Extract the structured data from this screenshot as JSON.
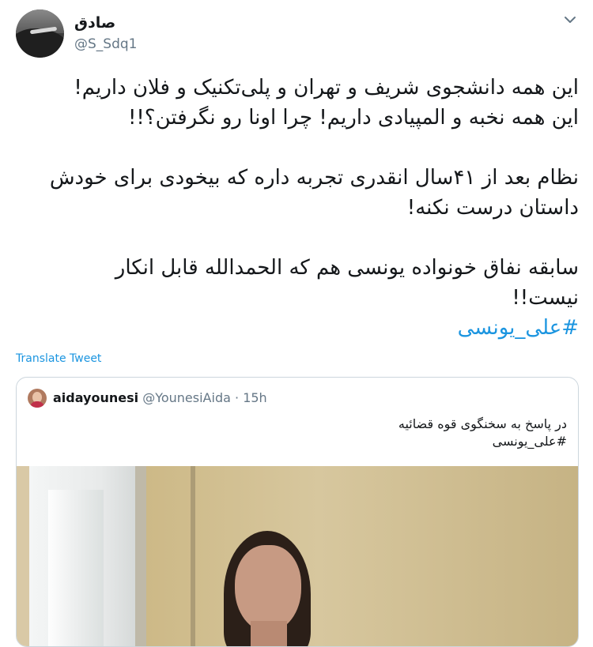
{
  "tweet": {
    "author_name": "صادق",
    "author_handle": "@S_Sdq1",
    "lines": [
      "این همه دانشجوی شریف و تهران و پلی‌تکنیک و فلان داریم!",
      "این همه نخبه و المپیادی داریم! چرا اونا رو نگرفتن؟!!",
      "نظام بعد از ۴۱سال انقدری تجربه داره که بیخودی برای خودش",
      "داستان درست نکنه!",
      "سابقه نفاق خونواده یونسی هم که الحمدالله قابل انکار",
      "نیست!!"
    ],
    "hashtag": "#علی_یونسی",
    "translate_label": "Translate Tweet",
    "menu_icon": "chevron-down-icon"
  },
  "quoted": {
    "author_name": "aidayounesi",
    "author_handle": "@YounesiAida",
    "separator": "·",
    "time": "15h",
    "text": "در پاسخ به سخنگوی قوه قضائیه",
    "hashtag": "#علی_یونسی"
  },
  "colors": {
    "link": "#1b95e0",
    "secondary_text": "#657786",
    "border": "#ccd6dd"
  }
}
